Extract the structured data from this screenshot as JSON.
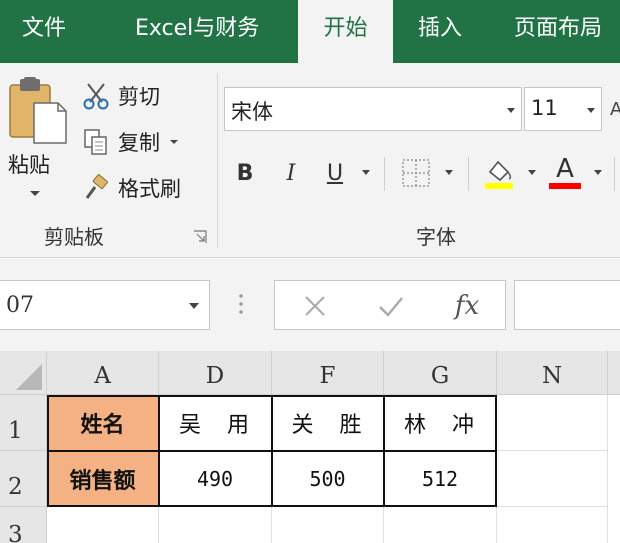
{
  "tabs": [
    {
      "label": "文件",
      "active": false
    },
    {
      "label": "Excel与财务",
      "active": false
    },
    {
      "label": "开始",
      "active": true
    },
    {
      "label": "插入",
      "active": false
    },
    {
      "label": "页面布局",
      "active": false
    }
  ],
  "clipboard": {
    "paste_label": "粘贴",
    "cut_label": "剪切",
    "copy_label": "复制",
    "format_painter_label": "格式刷",
    "group_label": "剪贴板"
  },
  "font": {
    "name": "宋体",
    "size": "11",
    "bold_label": "B",
    "italic_label": "I",
    "underline_label": "U",
    "font_color_label": "A",
    "fill_color": "#ffff00",
    "font_color": "#ff0000",
    "group_label": "字体"
  },
  "formula_bar": {
    "name_box": "07",
    "fx_label": "fx",
    "formula": ""
  },
  "sheet": {
    "columns": [
      "A",
      "D",
      "F",
      "G",
      "N"
    ],
    "rows": [
      "1",
      "2",
      "3"
    ],
    "cells": [
      [
        "姓名",
        "吴　用",
        "关　胜",
        "林　冲",
        ""
      ],
      [
        "销售额",
        "490",
        "500",
        "512",
        ""
      ]
    ],
    "header_fill": "#f4b183"
  }
}
